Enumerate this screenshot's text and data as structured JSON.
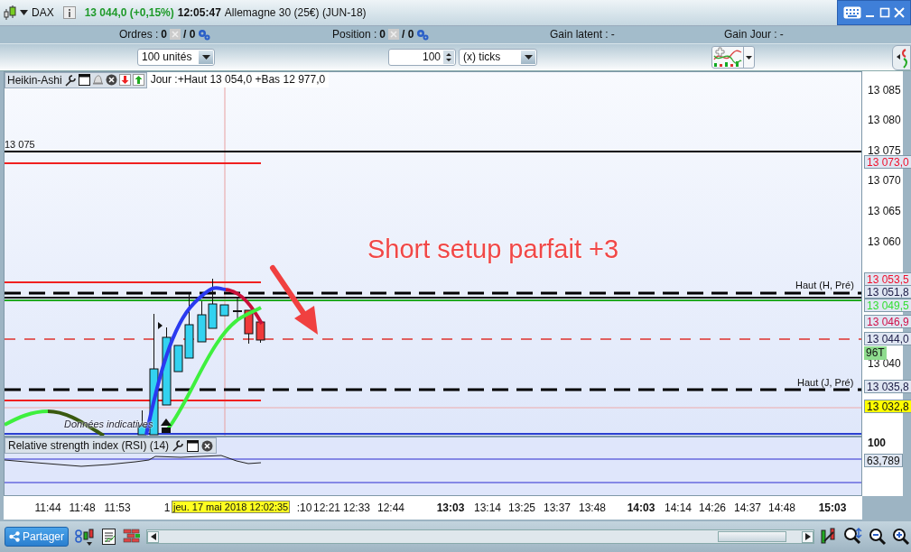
{
  "window": {
    "symbol": "DAX",
    "price": "13 044,0 (+0,15%)",
    "time": "12:05:47",
    "instrument": "Allemagne 30 (25€) (JUN-18)"
  },
  "account_bar": [
    {
      "kind": "count",
      "label": "Ordres :",
      "count": "0",
      "total": "/ 0"
    },
    {
      "kind": "count",
      "label": "Position :",
      "count": "0",
      "total": "/ 0"
    },
    {
      "kind": "gain",
      "label": "Gain latent :",
      "value": "-"
    },
    {
      "kind": "gain",
      "label": "Gain Jour :",
      "value": "-"
    }
  ],
  "toolbar": {
    "quantity": "100 unités",
    "ticks_value": "100",
    "ticks_unit": "(x) ticks"
  },
  "chart": {
    "style": "Heikin-Ashi",
    "info": "Jour :+Haut 13 054,0 +Bas 12 977,0",
    "level_labels": [
      "13 075",
      "Haut (H, Pré)",
      "Haut (J, Pré)"
    ],
    "notice": "Données indicatives",
    "annotation": "Short setup parfait +3",
    "price_ticks": [
      "13 085",
      "13 080",
      "13 075",
      "13 070",
      "13 065",
      "13 060",
      "13 040"
    ],
    "price_tags": [
      {
        "text": "13 073,0",
        "kind": "tag",
        "color": "#f0102c"
      },
      {
        "text": "13 053,5",
        "kind": "tag",
        "color": "#f0102c"
      },
      {
        "text": "13 051,8",
        "kind": "tag",
        "color": "#20204a"
      },
      {
        "text": "13 049,5",
        "kind": "tag",
        "color": "#33e033"
      },
      {
        "text": "13 046,9",
        "kind": "tag",
        "color": "#d0104a"
      },
      {
        "text": "13 044,0",
        "kind": "tag",
        "color": "#20204a"
      },
      {
        "text": "96T",
        "kind": "badge",
        "color": "#8edc8e"
      },
      {
        "text": "13 035,8",
        "kind": "tag",
        "color": "#20204a"
      },
      {
        "text": "13 032,8",
        "kind": "current",
        "color": "#ffff00"
      }
    ]
  },
  "rsi": {
    "title": "Relative strength index (RSI) (14)",
    "axis_label": "100",
    "value_tag": "63,789"
  },
  "time_axis": {
    "labels": [
      {
        "text": "11:44",
        "major": false
      },
      {
        "text": "11:48",
        "major": false
      },
      {
        "text": "11:53",
        "major": false
      },
      {
        "text": "1",
        "major": false
      },
      {
        "text": ":10",
        "major": false
      },
      {
        "text": "12:21",
        "major": false
      },
      {
        "text": "12:33",
        "major": false
      },
      {
        "text": "12:44",
        "major": false
      },
      {
        "text": "13:03",
        "major": true
      },
      {
        "text": "13:14",
        "major": false
      },
      {
        "text": "13:25",
        "major": false
      },
      {
        "text": "13:37",
        "major": false
      },
      {
        "text": "13:48",
        "major": false
      },
      {
        "text": "14:03",
        "major": true
      },
      {
        "text": "14:14",
        "major": false
      },
      {
        "text": "14:26",
        "major": false
      },
      {
        "text": "14:37",
        "major": false
      },
      {
        "text": "14:48",
        "major": false
      },
      {
        "text": "15:03",
        "major": true
      }
    ],
    "cursor": "jeu. 17 mai 2018 12:02:35"
  },
  "bottom_bar": {
    "share": "Partager"
  }
}
